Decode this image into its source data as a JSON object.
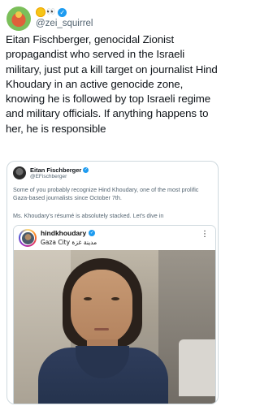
{
  "author": {
    "handle": "@zei_squirrel",
    "emoji": "👀"
  },
  "tweet": {
    "text": "Eitan Fischberger, genocidal Zionist propagandist who served in the Israeli military, just put a kill target on journalist Hind Khoudary in an active genocide zone, knowing he is followed by top Israeli regime and military officials. If anything happens to her, he is responsible"
  },
  "quote": {
    "name": "Eitan Fischberger",
    "handle": "@EFischberger",
    "text1": "Some of you probably recognize Hind Khoudary, one of the most prolific Gaza-based journalists since October 7th.",
    "text2": "Ms. Khoudary's résumé is absolutely stacked. Let's dive in",
    "embedded_post": {
      "username": "hindkhoudary",
      "location": "Gaza City مدينة غزة",
      "more": "⋮"
    }
  },
  "colors": {
    "verified": "#1d9bf0",
    "text": "#0f1419",
    "secondary": "#536471",
    "border": "#cfd9de"
  },
  "icons": {
    "verified": "verified-badge-icon",
    "sun": "sun-emoji-icon",
    "eyes": "eyes-emoji-icon",
    "more": "more-vertical-icon"
  }
}
